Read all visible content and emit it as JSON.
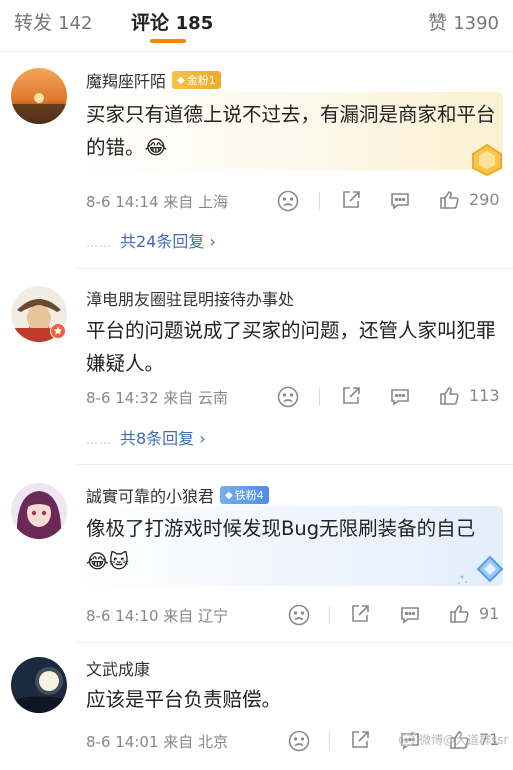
{
  "tabs": {
    "repost": {
      "label": "转发",
      "count": "142"
    },
    "comments": {
      "label": "评论",
      "count": "185"
    },
    "likes": {
      "label": "赞",
      "count": "1390"
    }
  },
  "comments": [
    {
      "username": "魔羯座阡陌",
      "badge": "金粉1",
      "text": "买家只有道德上说不过去，有漏洞是商家和平台的错。😂",
      "meta": "8-6 14:14  来自 上海",
      "likes": "290",
      "replies": "共24条回复 ›",
      "dots": "……"
    },
    {
      "username": "漳电朋友圈驻昆明接待办事处",
      "text": "平台的问题说成了买家的问题，还管人家叫犯罪嫌疑人。",
      "meta": "8-6 14:32  来自 云南",
      "likes": "113",
      "replies": "共8条回复 ›",
      "dots": "……"
    },
    {
      "username": "誠實可靠的小狼君",
      "badge": "铁粉4",
      "text": "像极了打游戏时候发现Bug无限刷装备的自己😂🐱",
      "meta": "8-6 14:10  来自 辽宁",
      "likes": "91"
    },
    {
      "username": "文武成康",
      "text": "应该是平台负责赔偿。",
      "meta": "8-6 14:01  来自 北京",
      "likes": "71"
    }
  ],
  "watermark": "微博@大道群ssr",
  "colors": {
    "accent": "#ff8200",
    "link": "#3d6eb5",
    "gold_badge": "#f0a92a",
    "iron_badge": "#4f8de4"
  }
}
